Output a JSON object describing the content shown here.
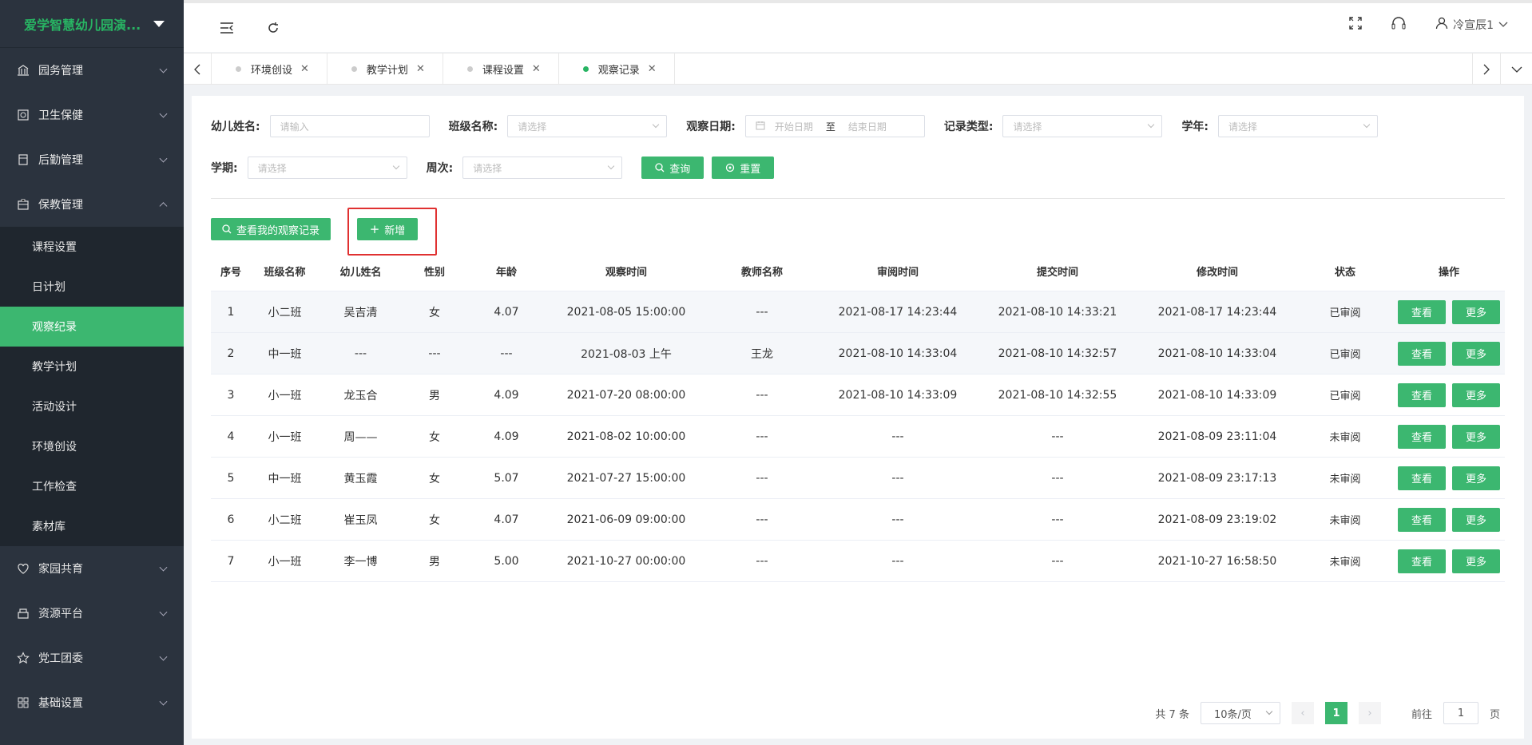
{
  "sidebar": {
    "brand": "爱学智慧幼儿园演...",
    "menus": [
      {
        "label": "园务管理",
        "icon": "bank-icon"
      },
      {
        "label": "卫生保健",
        "icon": "health-icon"
      },
      {
        "label": "后勤管理",
        "icon": "logistics-icon"
      },
      {
        "label": "保教管理",
        "icon": "education-icon"
      }
    ],
    "submenu": [
      "课程设置",
      "日计划",
      "观察纪录",
      "教学计划",
      "活动设计",
      "环境创设",
      "工作检查",
      "素材库"
    ],
    "menus_bottom": [
      {
        "label": "家园共育",
        "icon": "home-school-icon"
      },
      {
        "label": "资源平台",
        "icon": "resource-icon"
      },
      {
        "label": "党工团委",
        "icon": "star-icon"
      },
      {
        "label": "基础设置",
        "icon": "grid-icon"
      }
    ]
  },
  "header": {
    "user": "冷宣辰1"
  },
  "tabs": [
    {
      "label": "环境创设"
    },
    {
      "label": "教学计划"
    },
    {
      "label": "课程设置"
    },
    {
      "label": "观察记录"
    }
  ],
  "filters": {
    "child_name": {
      "label": "幼儿姓名:",
      "placeholder": "请输入"
    },
    "class_name": {
      "label": "班级名称:",
      "placeholder": "请选择"
    },
    "obs_date": {
      "label": "观察日期:",
      "start": "开始日期",
      "sep": "至",
      "end": "结束日期"
    },
    "record_type": {
      "label": "记录类型:",
      "placeholder": "请选择"
    },
    "school_year": {
      "label": "学年:",
      "placeholder": "请选择"
    },
    "semester": {
      "label": "学期:",
      "placeholder": "请选择"
    },
    "week": {
      "label": "周次:",
      "placeholder": "请选择"
    },
    "query_btn": "查询",
    "reset_btn": "重置"
  },
  "actions": {
    "my_records": "查看我的观察记录",
    "add": "新增"
  },
  "table": {
    "headers": [
      "序号",
      "班级名称",
      "幼儿姓名",
      "性别",
      "年龄",
      "观察时间",
      "教师名称",
      "审阅时间",
      "提交时间",
      "修改时间",
      "状态",
      "操作"
    ],
    "view_label": "查看",
    "more_label": "更多",
    "rows": [
      [
        "1",
        "小二班",
        "吴吉清",
        "女",
        "4.07",
        "2021-08-05 15:00:00",
        "---",
        "2021-08-17 14:23:44",
        "2021-08-10 14:33:21",
        "2021-08-17 14:23:44",
        "已审阅"
      ],
      [
        "2",
        "中一班",
        "---",
        "---",
        "---",
        "2021-08-03 上午",
        "王龙",
        "2021-08-10 14:33:04",
        "2021-08-10 14:32:57",
        "2021-08-10 14:33:04",
        "已审阅"
      ],
      [
        "3",
        "小一班",
        "龙玉合",
        "男",
        "4.09",
        "2021-07-20 08:00:00",
        "---",
        "2021-08-10 14:33:09",
        "2021-08-10 14:32:55",
        "2021-08-10 14:33:09",
        "已审阅"
      ],
      [
        "4",
        "小一班",
        "周——",
        "女",
        "4.09",
        "2021-08-02 10:00:00",
        "---",
        "---",
        "---",
        "2021-08-09 23:11:04",
        "未审阅"
      ],
      [
        "5",
        "中一班",
        "黄玉霞",
        "女",
        "5.07",
        "2021-07-27 15:00:00",
        "---",
        "---",
        "---",
        "2021-08-09 23:17:13",
        "未审阅"
      ],
      [
        "6",
        "小二班",
        "崔玉凤",
        "女",
        "4.07",
        "2021-06-09 09:00:00",
        "---",
        "---",
        "---",
        "2021-08-09 23:19:02",
        "未审阅"
      ],
      [
        "7",
        "小一班",
        "李一博",
        "男",
        "5.00",
        "2021-10-27 00:00:00",
        "---",
        "---",
        "---",
        "2021-10-27 16:58:50",
        "未审阅"
      ]
    ]
  },
  "pager": {
    "total": "共 7 条",
    "size": "10条/页",
    "current": "1",
    "goto": "前往",
    "goto_value": "1",
    "page_unit": "页"
  }
}
